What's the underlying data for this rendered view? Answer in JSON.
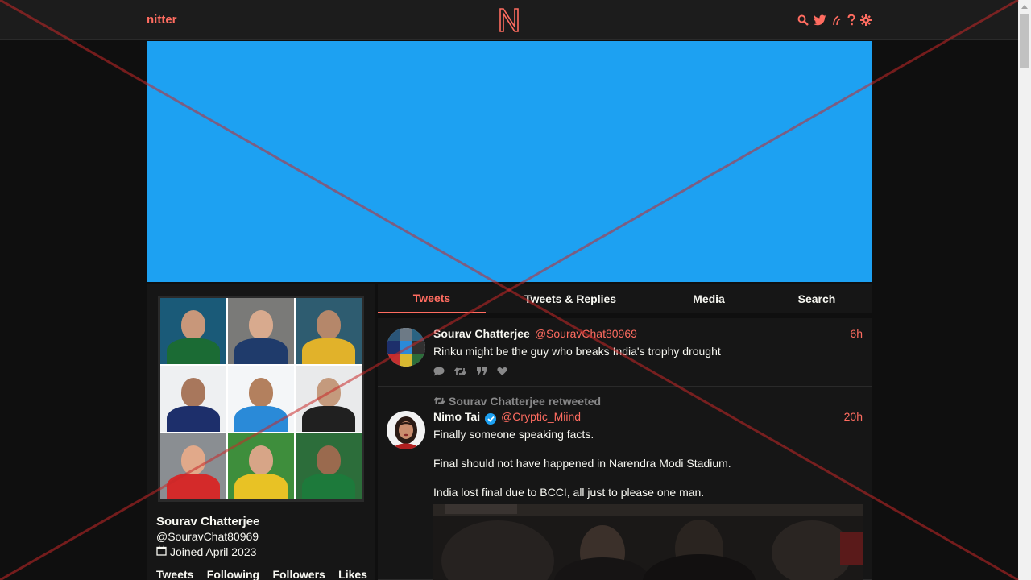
{
  "nav": {
    "site_name": "nitter",
    "logo_letter": "N",
    "icons": [
      "search-icon",
      "twitter-bird-icon",
      "rss-icon",
      "help-icon",
      "gear-icon"
    ]
  },
  "colors": {
    "accent": "#ff6c60",
    "banner": "#1da1f2",
    "background": "#0f0f0f",
    "panel": "#161616"
  },
  "profile": {
    "fullname": "Sourav Chatterjee",
    "username": "@SouravChat80969",
    "joined": "Joined April 2023",
    "stats": [
      "Tweets",
      "Following",
      "Followers",
      "Likes"
    ]
  },
  "tabs": [
    {
      "label": "Tweets",
      "active": true
    },
    {
      "label": "Tweets & Replies",
      "active": false
    },
    {
      "label": "Media",
      "active": false
    },
    {
      "label": "Search",
      "active": false
    }
  ],
  "tweets": [
    {
      "fullname": "Sourav Chatterjee",
      "username": "@SouravChat80969",
      "date": "6h",
      "text": "Rinku might be the guy who breaks India's trophy drought",
      "stats": [
        "comment-icon",
        "retweet-icon",
        "quote-icon",
        "heart-icon"
      ]
    },
    {
      "retweet_header": "Sourav Chatterjee retweeted",
      "fullname": "Nimo Tai",
      "username": "@Cryptic_Miind",
      "date": "20h",
      "verified": true,
      "text_lines": [
        "Finally someone speaking facts.",
        "Final should not have happened in Narendra Modi Stadium.",
        "India lost final due to BCCI, all just to please one man."
      ]
    }
  ]
}
